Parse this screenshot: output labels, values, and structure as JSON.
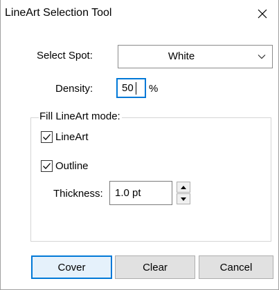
{
  "window": {
    "title": "LineArt Selection Tool",
    "close_icon": "close-icon"
  },
  "select_spot": {
    "label": "Select Spot:",
    "value": "White",
    "chevron_icon": "chevron-down-icon"
  },
  "density": {
    "label": "Density:",
    "value": "50",
    "unit": "%"
  },
  "fill_group": {
    "legend": "Fill LineArt mode:",
    "lineart": {
      "label": "LineArt",
      "checked": true
    },
    "outline": {
      "label": "Outline",
      "checked": true
    },
    "thickness": {
      "label": "Thickness:",
      "value": "1.0 pt",
      "up_icon": "spin-up-icon",
      "down_icon": "spin-down-icon"
    }
  },
  "buttons": {
    "cover": "Cover",
    "clear": "Clear",
    "cancel": "Cancel"
  },
  "colors": {
    "accent": "#0078d7",
    "button_face": "#e1e1e1",
    "default_button_face": "#e5f1fb"
  }
}
